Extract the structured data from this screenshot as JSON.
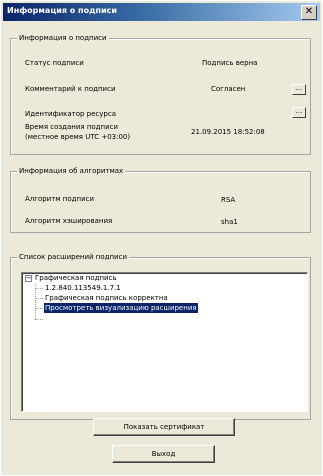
{
  "window": {
    "title": "Информация о подписи",
    "close_glyph": "✕"
  },
  "signature_info": {
    "legend": "Информация о подписи",
    "status_label": "Статус подписи",
    "status_value": "Подпись верна",
    "comment_label": "Комментарий к подписи",
    "comment_value": "Согласен",
    "resource_id_label": "Идентификатор ресурса",
    "resource_id_value": "",
    "created_label_line1": "Время создания подписи",
    "created_label_line2": "(местное время UTC +03:00)",
    "created_value": "21.09.2015 18:52:08",
    "ellipsis": "..."
  },
  "algorithms": {
    "legend": "Информация об алгоритмах",
    "sign_algo_label": "Алгоритм подписи",
    "sign_algo_value": "RSA",
    "hash_algo_label": "Алгоритм хэширования",
    "hash_algo_value": "sha1"
  },
  "extensions": {
    "legend": "Список расширений подписи",
    "expander_glyph": "−",
    "root": "Графическая подпись",
    "children": [
      "1.2.840.113549.1.7.1",
      "Графическая подпись корректна",
      "Просмотреть визуализацию расширения"
    ],
    "selected_index": 2
  },
  "buttons": {
    "show_cert": "Показать сертификат",
    "exit": "Выход"
  }
}
